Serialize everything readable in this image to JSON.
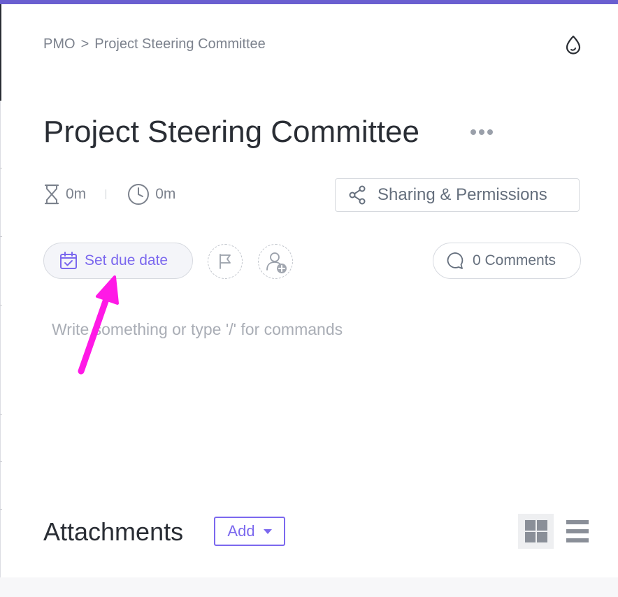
{
  "breadcrumb": {
    "parent": "PMO",
    "separator": ">",
    "current": "Project Steering Committee"
  },
  "task": {
    "title": "Project Steering Committee"
  },
  "time": {
    "estimate": "0m",
    "tracked": "0m"
  },
  "actions": {
    "share_label": "Sharing & Permissions",
    "due_date_label": "Set due date",
    "comments_label": "0 Comments"
  },
  "editor": {
    "placeholder": "Write something or type '/' for commands"
  },
  "attachments": {
    "title": "Attachments",
    "add_label": "Add"
  },
  "colors": {
    "accent": "#7b68ee",
    "top_bar": "#6a5fd0",
    "annotation_arrow": "#ff19e6"
  },
  "icons": [
    "water-drop-icon",
    "more-dots-icon",
    "hourglass-icon",
    "clock-icon",
    "share-icon",
    "calendar-icon",
    "flag-icon",
    "add-assignee-icon",
    "comment-icon",
    "grid-view-icon",
    "list-view-icon"
  ]
}
